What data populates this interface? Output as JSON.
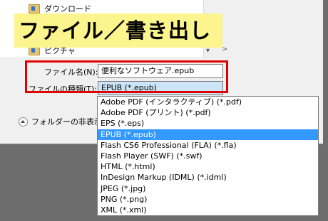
{
  "tree": {
    "items": [
      {
        "label": "ダウンロード",
        "icon": "download-folder-icon"
      },
      {
        "label": "ピクチャ",
        "icon": "pictures-folder-icon"
      }
    ]
  },
  "banner": {
    "text": "ファイル／書き出し"
  },
  "filename": {
    "label": "ファイル名(N):",
    "value": "便利なソフトウェア.epub"
  },
  "filetype": {
    "label": "ファイルの種類(T):",
    "value": "EPUB (*.epub)"
  },
  "folder_toggle": {
    "label": "フォルダーの非表示"
  },
  "scroll": {
    "down_arrow": "▾",
    "right_arrow": ">"
  },
  "dropdown": {
    "selected": "EPUB (*.epub)",
    "options": [
      "Adobe PDF (インタラクティブ) (*.pdf)",
      "Adobe PDF (プリント) (*.pdf)",
      "EPS (*.eps)",
      "EPUB (*.epub)",
      "Flash CS6 Professional (FLA) (*.fla)",
      "Flash Player (SWF) (*.swf)",
      "HTML (*.html)",
      "InDesign Markup (IDML) (*.idml)",
      "JPEG (*.jpg)",
      "PNG (*.png)",
      "XML (*.xml)"
    ]
  },
  "colors": {
    "highlight": "#3399ff",
    "callout": "#e00000",
    "banner": "#fcf48c"
  }
}
